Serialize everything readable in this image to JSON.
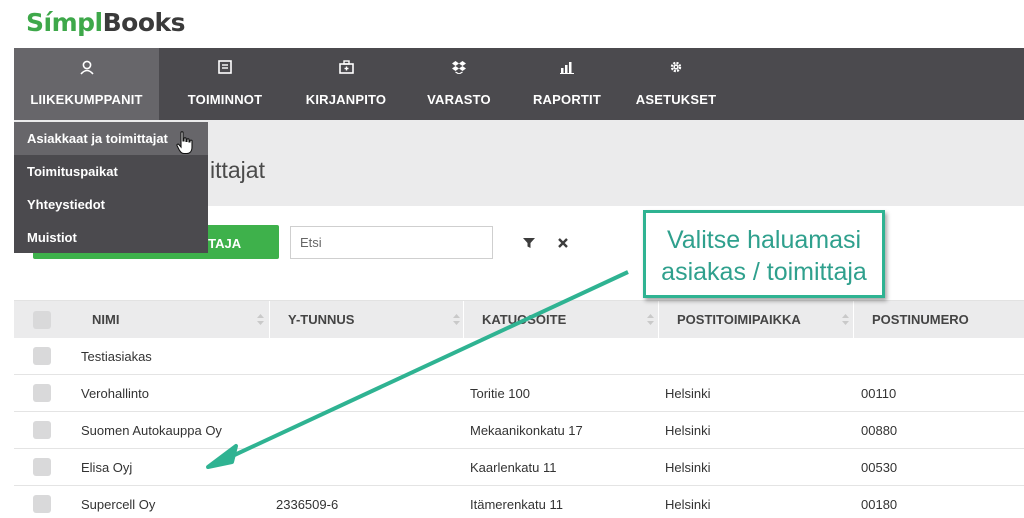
{
  "logo": {
    "part1": "Símpl",
    "part2": "Books"
  },
  "nav": [
    {
      "label": "LIIKEKUMPPANIT",
      "icon": "person-icon",
      "active": true
    },
    {
      "label": "TOIMINNOT",
      "icon": "list-icon"
    },
    {
      "label": "KIRJANPITO",
      "icon": "briefcase-icon"
    },
    {
      "label": "VARASTO",
      "icon": "dropbox-icon"
    },
    {
      "label": "RAPORTIT",
      "icon": "bar-chart-icon"
    },
    {
      "label": "ASETUKSET",
      "icon": "gear-icon"
    }
  ],
  "dropdown": [
    {
      "label": "Asiakkaat ja toimittajat"
    },
    {
      "label": "Toimituspaikat"
    },
    {
      "label": "Yhteystiedot"
    },
    {
      "label": "Muistiot"
    }
  ],
  "page": {
    "title_visible": "ittajat",
    "add_button_visible": "IITTAJA",
    "search_placeholder": "Etsi"
  },
  "table": {
    "columns": [
      "NIMI",
      "Y-TUNNUS",
      "KATUOSOITE",
      "POSTITOIMIPAIKKA",
      "POSTINUMERO"
    ],
    "rows": [
      {
        "nimi": "Testiasiakas",
        "ytunnus": "",
        "katuosoite": "",
        "postitoimipaikka": "",
        "postinumero": ""
      },
      {
        "nimi": "Verohallinto",
        "ytunnus": "",
        "katuosoite": "Toritie 100",
        "postitoimipaikka": "Helsinki",
        "postinumero": "00110"
      },
      {
        "nimi": "Suomen Autokauppa Oy",
        "ytunnus": "",
        "katuosoite": "Mekaanikonkatu 17",
        "postitoimipaikka": "Helsinki",
        "postinumero": "00880"
      },
      {
        "nimi": "Elisa Oyj",
        "ytunnus": "",
        "katuosoite": "Kaarlenkatu 11",
        "postitoimipaikka": "Helsinki",
        "postinumero": "00530"
      },
      {
        "nimi": "Supercell Oy",
        "ytunnus": "2336509-6",
        "katuosoite": "Itämerenkatu 11",
        "postitoimipaikka": "Helsinki",
        "postinumero": "00180"
      }
    ]
  },
  "callout": {
    "line1": "Valitse haluamasi",
    "line2": "asiakas / toimittaja"
  },
  "colors": {
    "accent_green": "#3eb14b",
    "navbar": "#4b4a4e",
    "callout": "#2fb392"
  }
}
